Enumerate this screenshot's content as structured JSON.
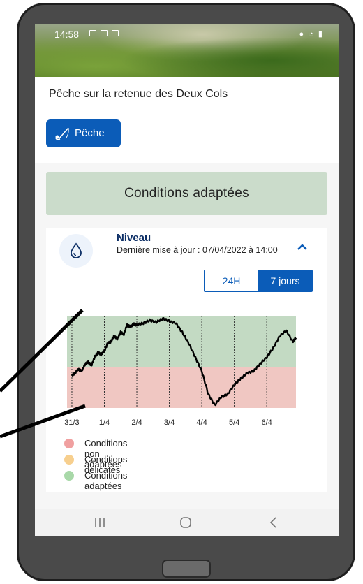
{
  "status_bar": {
    "time": "14:58"
  },
  "page": {
    "title": "Pêche sur la retenue des Deux Cols",
    "activity_button_label": "Pêche"
  },
  "conditions_banner": {
    "text": "Conditions adaptées",
    "color": "#cbdccb"
  },
  "niveau": {
    "title": "Niveau",
    "updated": "Dernière mise à jour : 07/04/2022 à 14:00",
    "range_options": [
      "24H",
      "7 jours"
    ],
    "selected_range": "7 jours"
  },
  "legend": [
    {
      "label": "Conditions non adaptées",
      "color": "#f0a0a0"
    },
    {
      "label": "Conditions délicates",
      "color": "#f7cf8e"
    },
    {
      "label": "Conditions adaptées",
      "color": "#a8d8a8"
    }
  ],
  "chart_data": {
    "type": "line",
    "x_tick_labels": [
      "31/3",
      "1/4",
      "2/4",
      "3/4",
      "4/4",
      "5/4",
      "6/4"
    ],
    "x_days": [
      0,
      1,
      2,
      3,
      4,
      5,
      6
    ],
    "threshold_level": 0.44,
    "series": [
      {
        "x": [
          0,
          0.1,
          0.2,
          0.3,
          0.4,
          0.5,
          0.6,
          0.7,
          0.8,
          0.9,
          1.0,
          1.1,
          1.2,
          1.3,
          1.4,
          1.5,
          1.6,
          1.7,
          1.8,
          1.9,
          2.0,
          2.2,
          2.4,
          2.6,
          2.8,
          3.0,
          3.2,
          3.4,
          3.6,
          3.8,
          4.0,
          4.2,
          4.4,
          4.6,
          4.8,
          5.0,
          5.2,
          5.4,
          5.6,
          5.8,
          6.0,
          6.2,
          6.4,
          6.6,
          6.8,
          6.9
        ],
        "y": [
          0.35,
          0.38,
          0.42,
          0.4,
          0.47,
          0.5,
          0.46,
          0.55,
          0.6,
          0.58,
          0.62,
          0.7,
          0.72,
          0.78,
          0.75,
          0.82,
          0.8,
          0.9,
          0.88,
          0.91,
          0.9,
          0.92,
          0.95,
          0.93,
          0.97,
          0.94,
          0.92,
          0.82,
          0.7,
          0.55,
          0.4,
          0.15,
          0.03,
          0.12,
          0.15,
          0.25,
          0.32,
          0.38,
          0.4,
          0.48,
          0.55,
          0.65,
          0.78,
          0.84,
          0.72,
          0.76
        ]
      }
    ],
    "colors": {
      "green_zone": "#c3dac3",
      "red_zone": "#f0c7c2",
      "line": "#000000"
    }
  }
}
